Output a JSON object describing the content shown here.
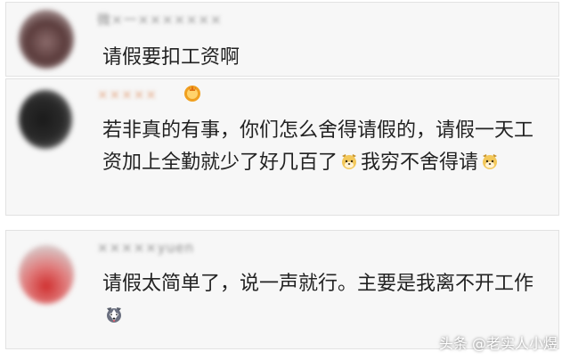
{
  "comments": [
    {
      "username": "微×一×××××××",
      "text": "请假要扣工资啊"
    },
    {
      "username": "×××××",
      "text_part1": "若非真的有事，你们怎么舍得请假的，请假一天工资加上全勤就少了好几百了",
      "text_part2": "我穷不舍得请",
      "emoji": "dog-face-emoji"
    },
    {
      "username": "×××××yuen",
      "text": "请假太简单了，说一声就行。主要是我离不开工作",
      "emoji": "husky-face-emoji"
    }
  ],
  "watermark": "头条 @老实人小煜",
  "colors": {
    "card_bg": "#f7f7f7",
    "card_border": "#e2e2e2",
    "text": "#222222",
    "username": "#9a9a9a",
    "badge": "#f0a020"
  }
}
